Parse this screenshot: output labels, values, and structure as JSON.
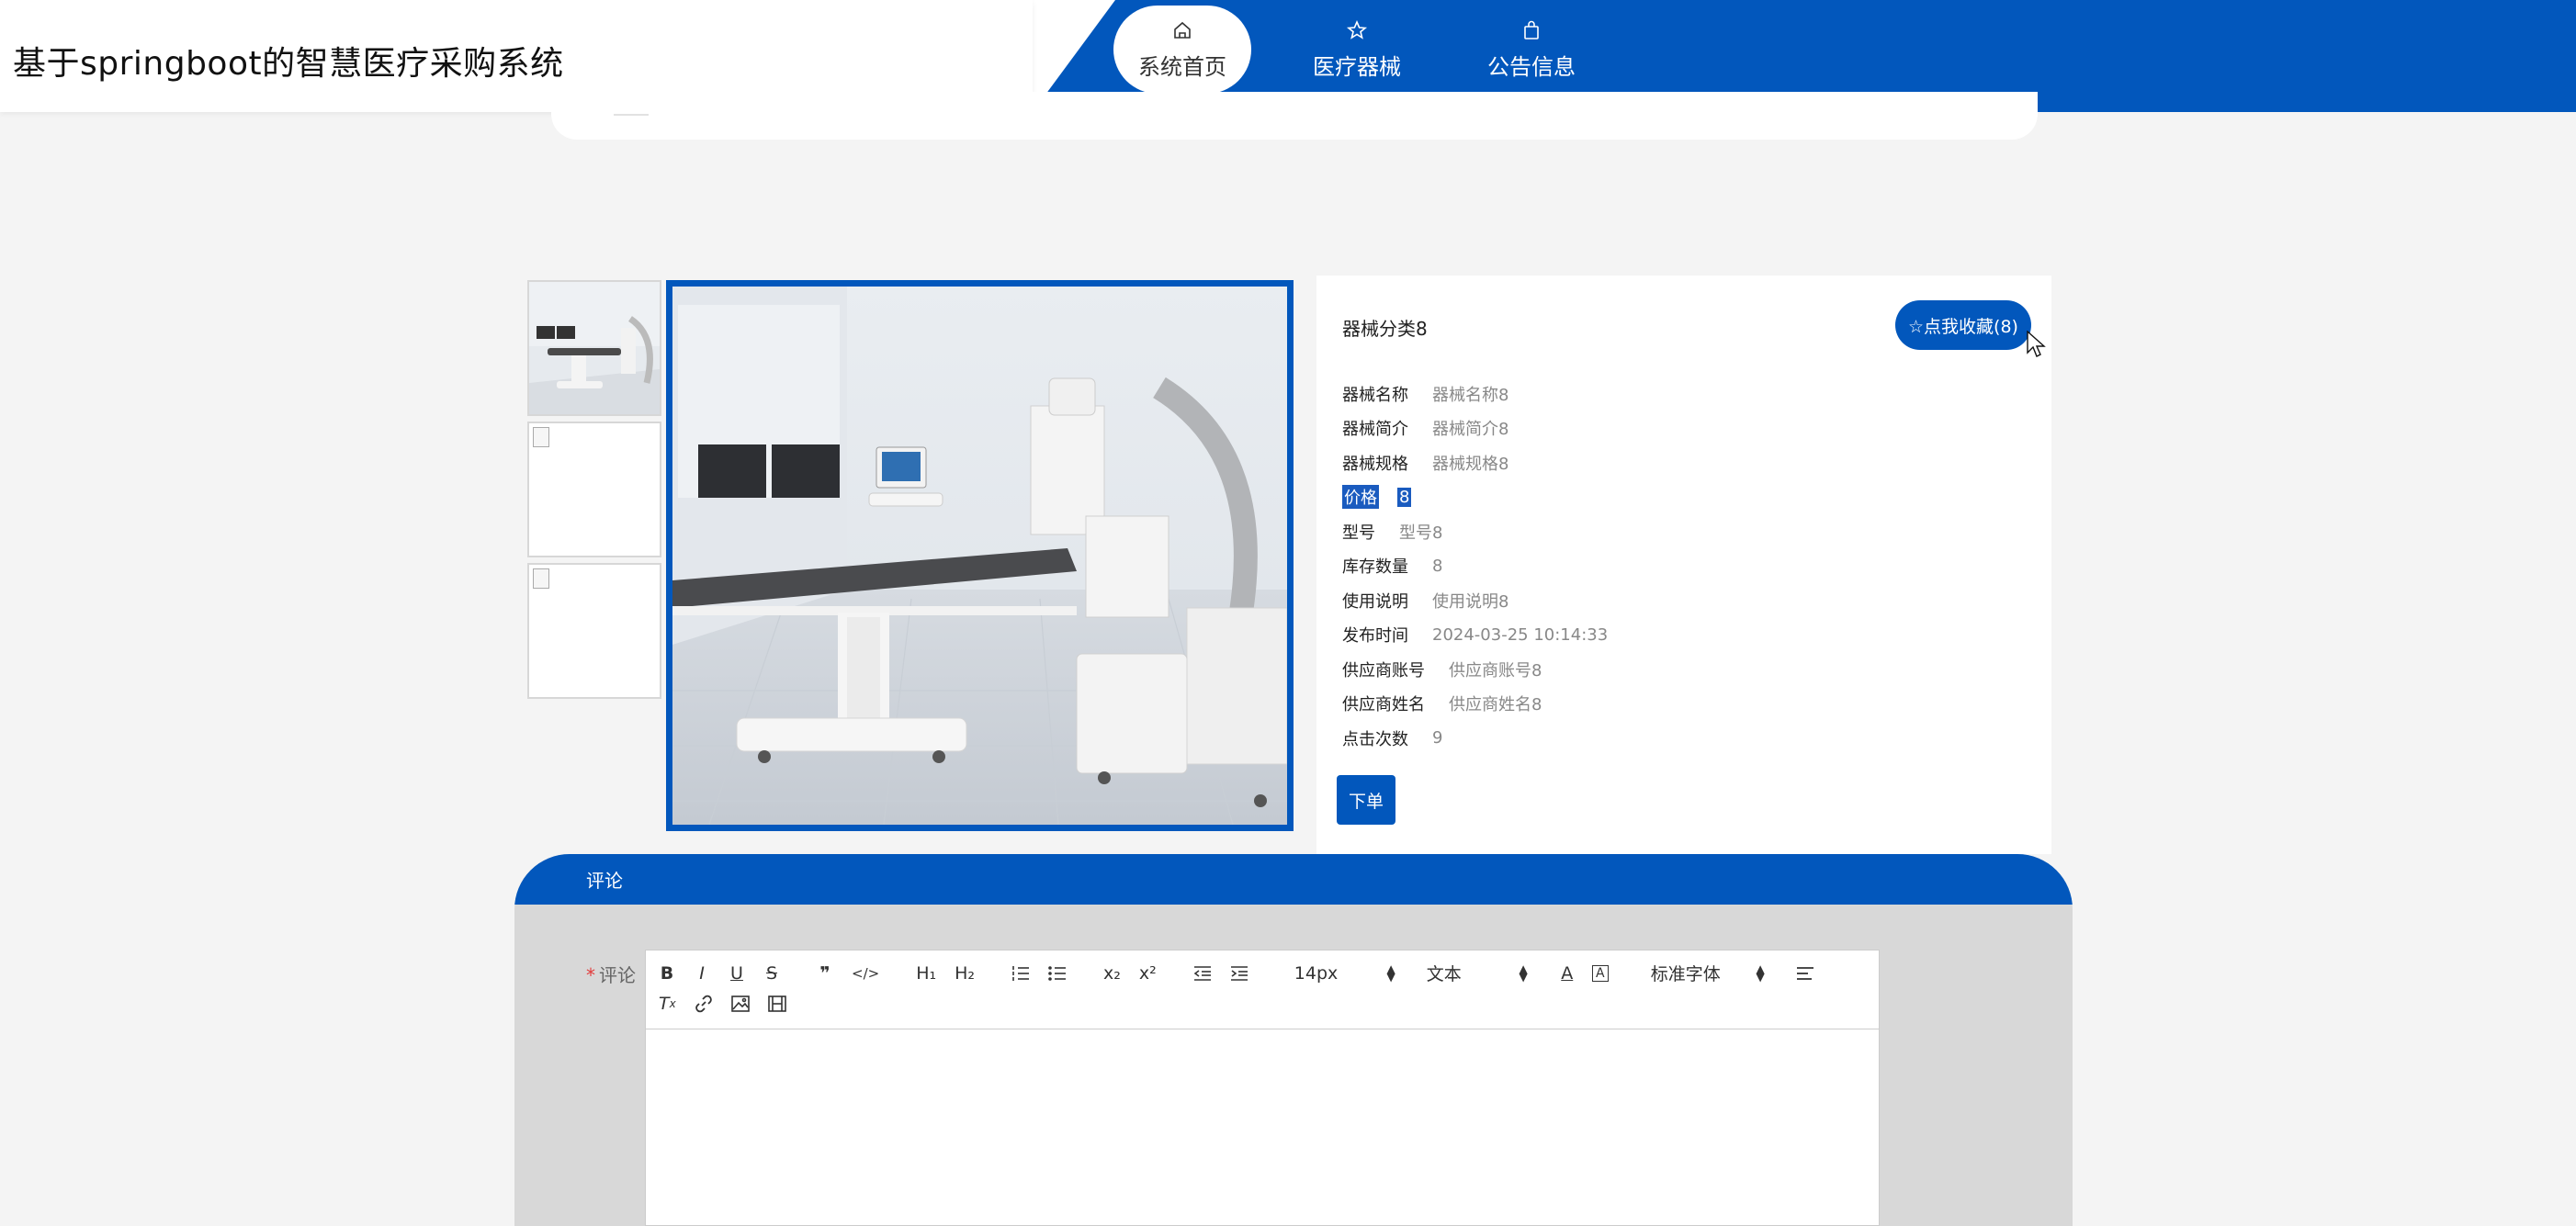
{
  "header": {
    "site_title": "基于springboot的智慧医疗采购系统",
    "brand_color": "#0257bc",
    "nav": [
      {
        "label": "系统首页",
        "icon": "home-icon",
        "active": true
      },
      {
        "label": "医疗器械",
        "icon": "star-icon",
        "active": false
      },
      {
        "label": "公告信息",
        "icon": "bag-icon",
        "active": false
      }
    ]
  },
  "product": {
    "category": "器械分类8",
    "favorite_label": "☆点我收藏(8)",
    "fields": [
      {
        "label": "器械名称",
        "value": "器械名称8"
      },
      {
        "label": "器械简介",
        "value": "器械简介8"
      },
      {
        "label": "器械规格",
        "value": "器械规格8"
      },
      {
        "label": "价格",
        "value": "8"
      },
      {
        "label": "型号",
        "value": "型号8"
      },
      {
        "label": "库存数量",
        "value": "8"
      },
      {
        "label": "使用说明",
        "value": "使用说明8"
      },
      {
        "label": "发布时间",
        "value": "2024-03-25 10:14:33"
      },
      {
        "label": "供应商账号",
        "value": "供应商账号8"
      },
      {
        "label": "供应商姓名",
        "value": "供应商姓名8"
      },
      {
        "label": "点击次数",
        "value": "9"
      }
    ],
    "order_label": "下单"
  },
  "comments": {
    "section_title": "评论",
    "field_label": "评论",
    "required_mark": "*",
    "toolbar": {
      "font_size": "14px",
      "text_type": "文本",
      "font_family": "标准字体"
    }
  }
}
